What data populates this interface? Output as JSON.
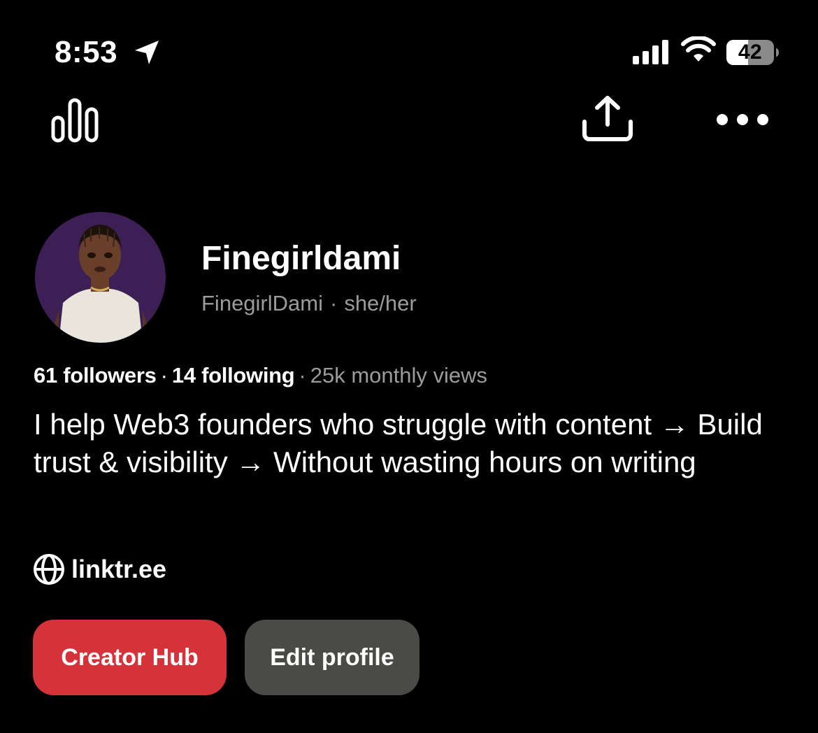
{
  "status_bar": {
    "time": "8:53",
    "battery_level": "42"
  },
  "profile": {
    "display_name": "Finegirldami",
    "username": "FinegirlDami",
    "separator": "·",
    "pronouns": "she/her",
    "followers": "61 followers",
    "following": "14 following",
    "monthly_views": "25k monthly views",
    "bio": "I help Web3 founders who struggle with content → Build trust & visibility → Without wasting hours on writing",
    "website": "linktr.ee"
  },
  "buttons": {
    "creator_hub": "Creator Hub",
    "edit_profile": "Edit profile"
  },
  "colors": {
    "background": "#000000",
    "creator_hub_bg": "#d6323a",
    "edit_profile_bg": "#4a4a46",
    "muted_text": "#9b9b9b",
    "avatar_bg": "#3c1f54"
  },
  "icons": {
    "analytics": "analytics-icon",
    "share": "share-icon",
    "more": "more-icon",
    "globe": "globe-icon",
    "location": "location-arrow-icon",
    "signal": "signal-icon",
    "wifi": "wifi-icon",
    "battery": "battery-icon"
  }
}
